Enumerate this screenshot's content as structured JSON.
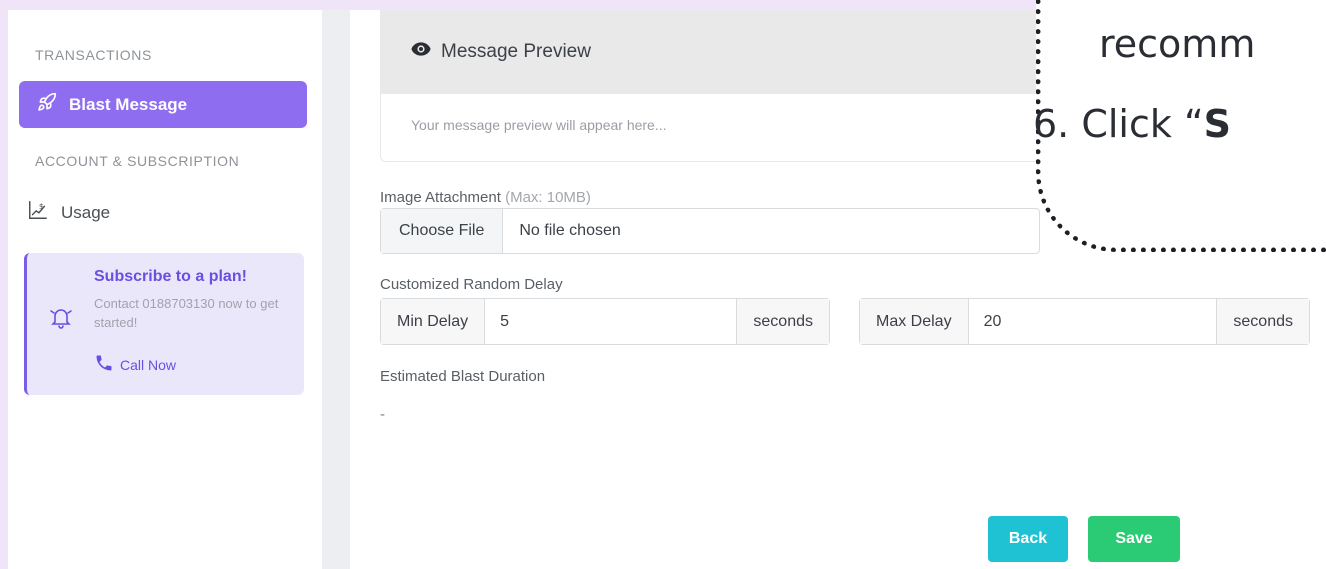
{
  "sidebar": {
    "section_transactions": "TRANSACTIONS",
    "active_item": "Blast Message",
    "section_account": "ACCOUNT & SUBSCRIPTION",
    "usage_item": "Usage",
    "promo": {
      "title": "Subscribe to a plan!",
      "text": "Contact 0188703130 now to get started!",
      "call_label": "Call Now"
    }
  },
  "preview": {
    "title": "Message Preview",
    "placeholder": "Your message preview will appear here..."
  },
  "attachment": {
    "label": "Image Attachment",
    "hint": "(Max: 10MB)",
    "button": "Choose File",
    "file_status": "No file chosen"
  },
  "delay": {
    "label": "Customized Random Delay",
    "min_label": "Min Delay",
    "min_value": "5",
    "max_label": "Max Delay",
    "max_value": "20",
    "unit": "seconds"
  },
  "estimate": {
    "label": "Estimated Blast Duration",
    "value": "-"
  },
  "actions": {
    "back": "Back",
    "save": "Save"
  },
  "callout": {
    "line1": "recomm",
    "line2_prefix": "6. Click “",
    "line2_bold": "S"
  },
  "colors": {
    "accent": "#8f6df0",
    "back_button": "#1fc2d3",
    "save_button": "#2bca74",
    "background": "#efe4f8"
  }
}
